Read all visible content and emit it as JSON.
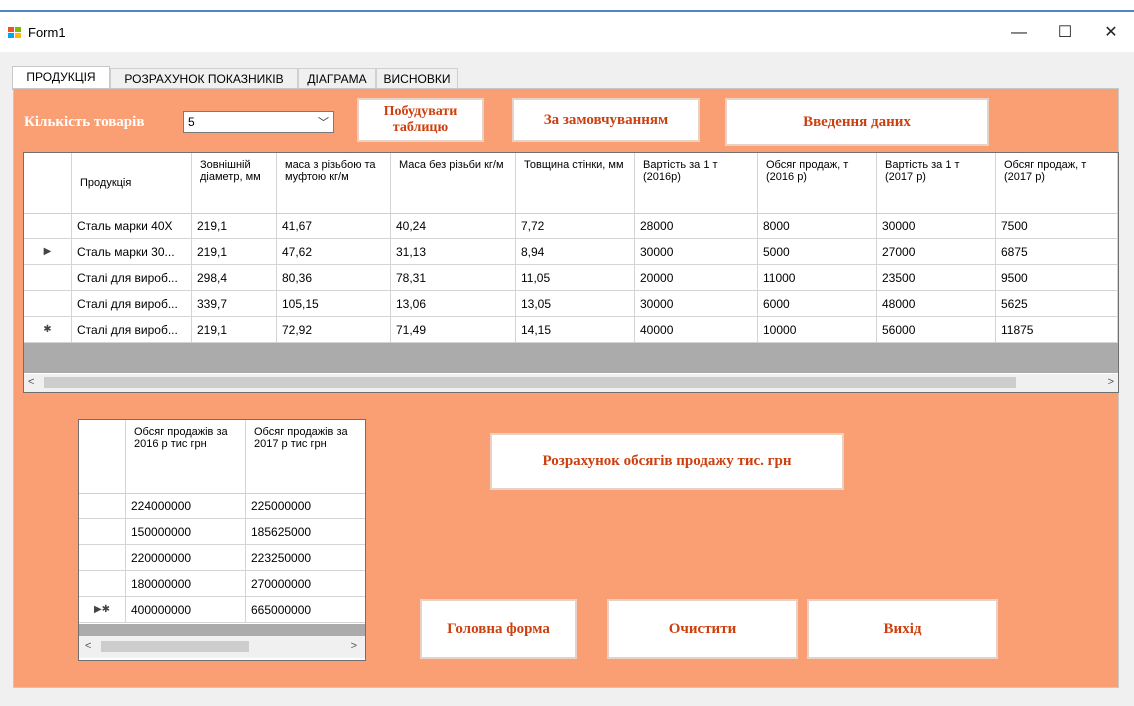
{
  "window": {
    "title": "Form1",
    "minimize": "—",
    "maximize": "☐",
    "close": "✕",
    "top_partial": "..."
  },
  "tabs": [
    {
      "label": "ПРОДУКЦІЯ",
      "active": true
    },
    {
      "label": "РОЗРАХУНОК ПОКАЗНИКІВ",
      "active": false
    },
    {
      "label": "ДІАГРАМА",
      "active": false
    },
    {
      "label": "ВИСНОВКИ",
      "active": false
    }
  ],
  "controls": {
    "count_label": "Кількість товарів",
    "count_value": "5",
    "build_table": "Побудувати таблицю",
    "default": "За замовчуванням",
    "input_data": "Введення  даних",
    "calc_sales": "Розрахунок обсягів продажу тис. грн",
    "main_form": "Головна форма",
    "clear": "Очистити",
    "exit": "Вихід"
  },
  "main_grid": {
    "columns": [
      "Продукція",
      "Зовнішній діаметр, мм",
      "маса з різьбою та муфтою кг/м",
      "Маса без різьби кг/м",
      "Товщина стінки, мм",
      "Вартість за 1 т (2016р)",
      "Обсяг продаж, т (2016 р)",
      "Вартість за 1 т (2017 р)",
      "Обсяг продаж, т (2017 р)"
    ],
    "rows": [
      {
        "marker": "",
        "cells": [
          "Сталь марки 40Х",
          "219,1",
          "41,67",
          "40,24",
          "7,72",
          "28000",
          "8000",
          "30000",
          "7500"
        ]
      },
      {
        "marker": "▶",
        "cells": [
          "Сталь марки 30...",
          "219,1",
          "47,62",
          "31,13",
          "8,94",
          "30000",
          "5000",
          "27000",
          "6875"
        ]
      },
      {
        "marker": "",
        "cells": [
          "Сталі для вироб...",
          "298,4",
          "80,36",
          "78,31",
          "11,05",
          "20000",
          "11000",
          "23500",
          "9500"
        ]
      },
      {
        "marker": "",
        "cells": [
          "Сталі для вироб...",
          "339,7",
          "105,15",
          "13,06",
          "13,05",
          "30000",
          "6000",
          "48000",
          "5625"
        ]
      },
      {
        "marker": "✱",
        "cells": [
          "Сталі для вироб...",
          "219,1",
          "72,92",
          "71,49",
          "14,15",
          "40000",
          "10000",
          "56000",
          "11875"
        ]
      }
    ],
    "scroll_left": "<",
    "scroll_right": ">"
  },
  "sales_grid": {
    "columns": [
      "Обсяг продажів за 2016 р тис грн",
      "Обсяг продажів за 2017 р тис грн"
    ],
    "rows": [
      {
        "marker": "",
        "cells": [
          "224000000",
          "225000000"
        ]
      },
      {
        "marker": "",
        "cells": [
          "150000000",
          "185625000"
        ]
      },
      {
        "marker": "",
        "cells": [
          "220000000",
          "223250000"
        ]
      },
      {
        "marker": "",
        "cells": [
          "180000000",
          "270000000"
        ]
      },
      {
        "marker": "▶✱",
        "cells": [
          "400000000",
          "665000000"
        ]
      }
    ],
    "scroll_left": "<",
    "scroll_right": ">"
  },
  "colors": {
    "panel_bg": "#fa9f74",
    "button_text": "#cc4010",
    "label_text": "#ffffff"
  }
}
